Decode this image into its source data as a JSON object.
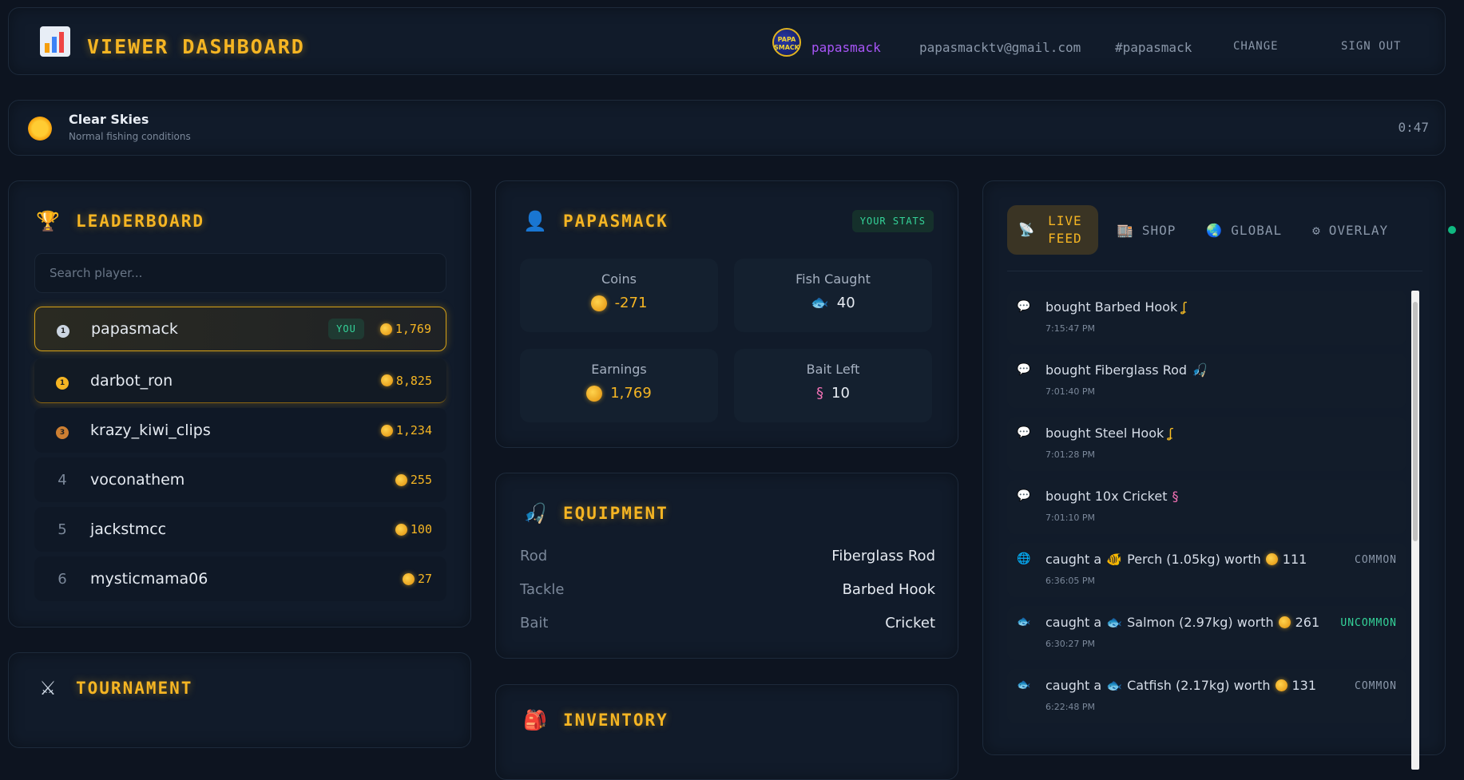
{
  "header": {
    "title": "VIEWER DASHBOARD",
    "avatar_text": "PAPA SMACK",
    "username": "papasmack",
    "email": "papasmacktv@gmail.com",
    "channel": "#papasmack",
    "change_label": "CHANGE",
    "signout_label": "SIGN OUT"
  },
  "weather": {
    "title": "Clear Skies",
    "subtitle": "Normal fishing conditions",
    "timer": "0:47"
  },
  "leaderboard": {
    "title": "LEADERBOARD",
    "search_placeholder": "Search player...",
    "you_label": "YOU",
    "rows": [
      {
        "rank": "1",
        "name": "papasmack",
        "coins": "1,769"
      },
      {
        "rank": "2",
        "name": "darbot_ron",
        "coins": "8,825"
      },
      {
        "rank": "3",
        "name": "krazy_kiwi_clips",
        "coins": "1,234"
      },
      {
        "rank": "4",
        "name": "voconathem",
        "coins": "255"
      },
      {
        "rank": "5",
        "name": "jackstmcc",
        "coins": "100"
      },
      {
        "rank": "6",
        "name": "mysticmama06",
        "coins": "27"
      }
    ]
  },
  "tournament": {
    "title": "TOURNAMENT"
  },
  "stats": {
    "title": "PAPASMACK",
    "badge": "YOUR STATS",
    "coins_label": "Coins",
    "coins_value": "-271",
    "fish_label": "Fish Caught",
    "fish_value": "40",
    "earnings_label": "Earnings",
    "earnings_value": "1,769",
    "bait_label": "Bait Left",
    "bait_value": "10"
  },
  "equipment": {
    "title": "EQUIPMENT",
    "rod_label": "Rod",
    "rod_value": "Fiberglass Rod",
    "tackle_label": "Tackle",
    "tackle_value": "Barbed Hook",
    "bait_label": "Bait",
    "bait_value": "Cricket"
  },
  "inventory": {
    "title": "INVENTORY"
  },
  "tabs": {
    "live_feed": "LIVE FEED",
    "shop": "SHOP",
    "global": "GLOBAL",
    "overlay": "OVERLAY"
  },
  "feed": [
    {
      "text": "bought Barbed Hook",
      "time": "7:15:47 PM",
      "rarity": ""
    },
    {
      "text": "bought Fiberglass Rod",
      "time": "7:01:40 PM",
      "rarity": ""
    },
    {
      "text": "bought Steel Hook",
      "time": "7:01:28 PM",
      "rarity": ""
    },
    {
      "text": "bought 10x Cricket",
      "time": "7:01:10 PM",
      "rarity": ""
    },
    {
      "pre": "caught a",
      "fish": "Perch (1.05kg) worth",
      "worth": "111",
      "time": "6:36:05 PM",
      "rarity": "COMMON"
    },
    {
      "pre": "caught a",
      "fish": "Salmon (2.97kg) worth",
      "worth": "261",
      "time": "6:30:27 PM",
      "rarity": "UNCOMMON"
    },
    {
      "pre": "caught a",
      "fish": "Catfish (2.17kg) worth",
      "worth": "131",
      "time": "6:22:48 PM",
      "rarity": "COMMON"
    }
  ],
  "colors": {
    "accent": "#f5b523",
    "username": "#a855f7",
    "common": "#8a97a9",
    "uncommon": "#34d399",
    "online": "#10b981"
  }
}
